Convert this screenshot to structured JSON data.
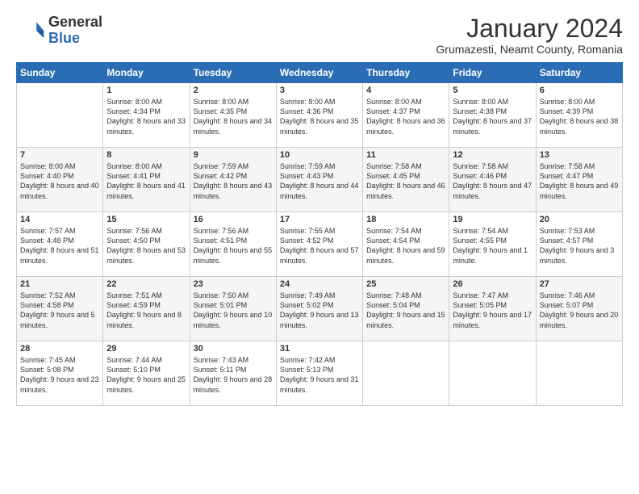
{
  "logo": {
    "general": "General",
    "blue": "Blue"
  },
  "header": {
    "title": "January 2024",
    "subtitle": "Grumazesti, Neamt County, Romania"
  },
  "columns": [
    "Sunday",
    "Monday",
    "Tuesday",
    "Wednesday",
    "Thursday",
    "Friday",
    "Saturday"
  ],
  "weeks": [
    [
      {
        "day": "",
        "empty": true
      },
      {
        "day": "1",
        "sunrise": "Sunrise: 8:00 AM",
        "sunset": "Sunset: 4:34 PM",
        "daylight": "Daylight: 8 hours and 33 minutes."
      },
      {
        "day": "2",
        "sunrise": "Sunrise: 8:00 AM",
        "sunset": "Sunset: 4:35 PM",
        "daylight": "Daylight: 8 hours and 34 minutes."
      },
      {
        "day": "3",
        "sunrise": "Sunrise: 8:00 AM",
        "sunset": "Sunset: 4:36 PM",
        "daylight": "Daylight: 8 hours and 35 minutes."
      },
      {
        "day": "4",
        "sunrise": "Sunrise: 8:00 AM",
        "sunset": "Sunset: 4:37 PM",
        "daylight": "Daylight: 8 hours and 36 minutes."
      },
      {
        "day": "5",
        "sunrise": "Sunrise: 8:00 AM",
        "sunset": "Sunset: 4:38 PM",
        "daylight": "Daylight: 8 hours and 37 minutes."
      },
      {
        "day": "6",
        "sunrise": "Sunrise: 8:00 AM",
        "sunset": "Sunset: 4:39 PM",
        "daylight": "Daylight: 8 hours and 38 minutes."
      }
    ],
    [
      {
        "day": "7",
        "sunrise": "Sunrise: 8:00 AM",
        "sunset": "Sunset: 4:40 PM",
        "daylight": "Daylight: 8 hours and 40 minutes."
      },
      {
        "day": "8",
        "sunrise": "Sunrise: 8:00 AM",
        "sunset": "Sunset: 4:41 PM",
        "daylight": "Daylight: 8 hours and 41 minutes."
      },
      {
        "day": "9",
        "sunrise": "Sunrise: 7:59 AM",
        "sunset": "Sunset: 4:42 PM",
        "daylight": "Daylight: 8 hours and 43 minutes."
      },
      {
        "day": "10",
        "sunrise": "Sunrise: 7:59 AM",
        "sunset": "Sunset: 4:43 PM",
        "daylight": "Daylight: 8 hours and 44 minutes."
      },
      {
        "day": "11",
        "sunrise": "Sunrise: 7:58 AM",
        "sunset": "Sunset: 4:45 PM",
        "daylight": "Daylight: 8 hours and 46 minutes."
      },
      {
        "day": "12",
        "sunrise": "Sunrise: 7:58 AM",
        "sunset": "Sunset: 4:46 PM",
        "daylight": "Daylight: 8 hours and 47 minutes."
      },
      {
        "day": "13",
        "sunrise": "Sunrise: 7:58 AM",
        "sunset": "Sunset: 4:47 PM",
        "daylight": "Daylight: 8 hours and 49 minutes."
      }
    ],
    [
      {
        "day": "14",
        "sunrise": "Sunrise: 7:57 AM",
        "sunset": "Sunset: 4:48 PM",
        "daylight": "Daylight: 8 hours and 51 minutes."
      },
      {
        "day": "15",
        "sunrise": "Sunrise: 7:56 AM",
        "sunset": "Sunset: 4:50 PM",
        "daylight": "Daylight: 8 hours and 53 minutes."
      },
      {
        "day": "16",
        "sunrise": "Sunrise: 7:56 AM",
        "sunset": "Sunset: 4:51 PM",
        "daylight": "Daylight: 8 hours and 55 minutes."
      },
      {
        "day": "17",
        "sunrise": "Sunrise: 7:55 AM",
        "sunset": "Sunset: 4:52 PM",
        "daylight": "Daylight: 8 hours and 57 minutes."
      },
      {
        "day": "18",
        "sunrise": "Sunrise: 7:54 AM",
        "sunset": "Sunset: 4:54 PM",
        "daylight": "Daylight: 8 hours and 59 minutes."
      },
      {
        "day": "19",
        "sunrise": "Sunrise: 7:54 AM",
        "sunset": "Sunset: 4:55 PM",
        "daylight": "Daylight: 9 hours and 1 minute."
      },
      {
        "day": "20",
        "sunrise": "Sunrise: 7:53 AM",
        "sunset": "Sunset: 4:57 PM",
        "daylight": "Daylight: 9 hours and 3 minutes."
      }
    ],
    [
      {
        "day": "21",
        "sunrise": "Sunrise: 7:52 AM",
        "sunset": "Sunset: 4:58 PM",
        "daylight": "Daylight: 9 hours and 5 minutes."
      },
      {
        "day": "22",
        "sunrise": "Sunrise: 7:51 AM",
        "sunset": "Sunset: 4:59 PM",
        "daylight": "Daylight: 9 hours and 8 minutes."
      },
      {
        "day": "23",
        "sunrise": "Sunrise: 7:50 AM",
        "sunset": "Sunset: 5:01 PM",
        "daylight": "Daylight: 9 hours and 10 minutes."
      },
      {
        "day": "24",
        "sunrise": "Sunrise: 7:49 AM",
        "sunset": "Sunset: 5:02 PM",
        "daylight": "Daylight: 9 hours and 13 minutes."
      },
      {
        "day": "25",
        "sunrise": "Sunrise: 7:48 AM",
        "sunset": "Sunset: 5:04 PM",
        "daylight": "Daylight: 9 hours and 15 minutes."
      },
      {
        "day": "26",
        "sunrise": "Sunrise: 7:47 AM",
        "sunset": "Sunset: 5:05 PM",
        "daylight": "Daylight: 9 hours and 17 minutes."
      },
      {
        "day": "27",
        "sunrise": "Sunrise: 7:46 AM",
        "sunset": "Sunset: 5:07 PM",
        "daylight": "Daylight: 9 hours and 20 minutes."
      }
    ],
    [
      {
        "day": "28",
        "sunrise": "Sunrise: 7:45 AM",
        "sunset": "Sunset: 5:08 PM",
        "daylight": "Daylight: 9 hours and 23 minutes."
      },
      {
        "day": "29",
        "sunrise": "Sunrise: 7:44 AM",
        "sunset": "Sunset: 5:10 PM",
        "daylight": "Daylight: 9 hours and 25 minutes."
      },
      {
        "day": "30",
        "sunrise": "Sunrise: 7:43 AM",
        "sunset": "Sunset: 5:11 PM",
        "daylight": "Daylight: 9 hours and 28 minutes."
      },
      {
        "day": "31",
        "sunrise": "Sunrise: 7:42 AM",
        "sunset": "Sunset: 5:13 PM",
        "daylight": "Daylight: 9 hours and 31 minutes."
      },
      {
        "day": "",
        "empty": true
      },
      {
        "day": "",
        "empty": true
      },
      {
        "day": "",
        "empty": true
      }
    ]
  ]
}
